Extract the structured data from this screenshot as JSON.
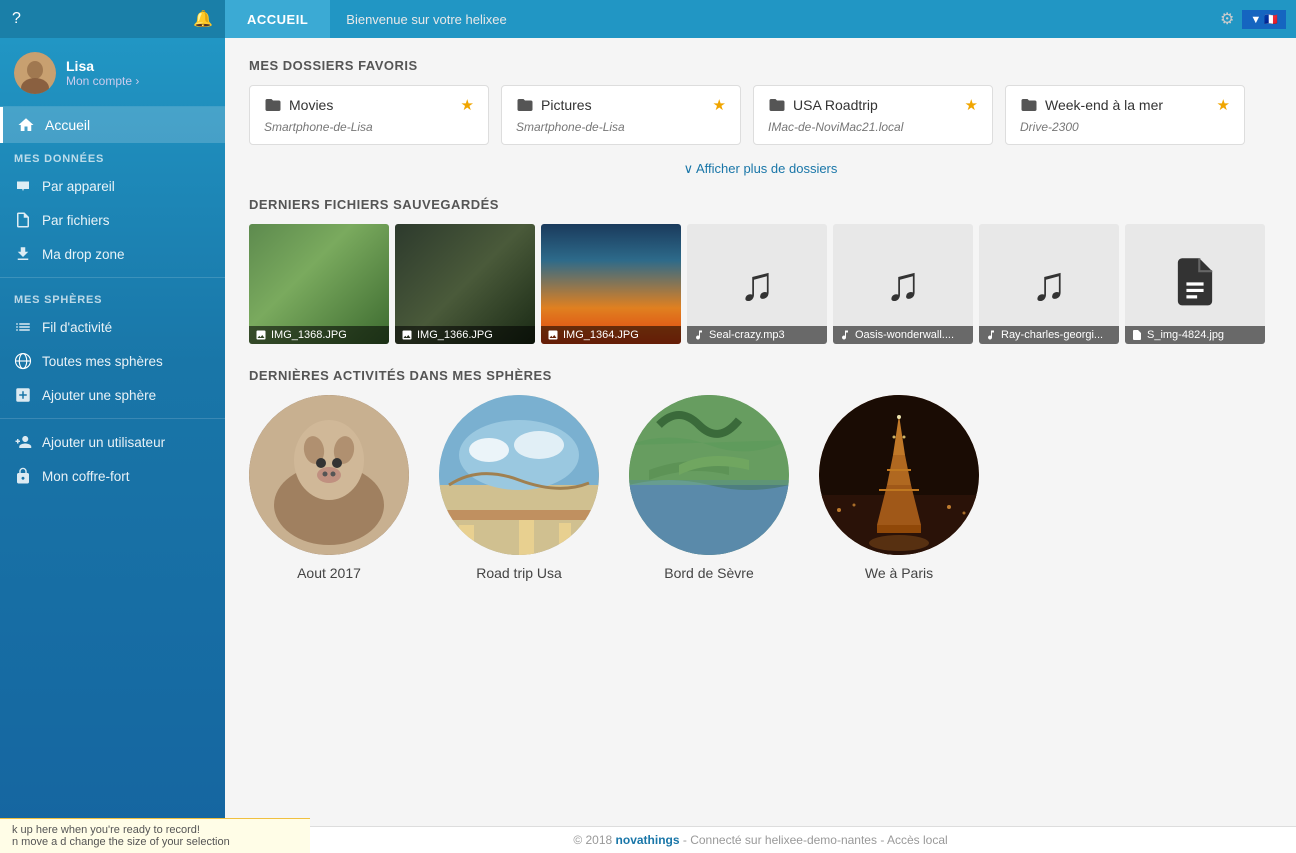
{
  "topbar": {
    "nav_label": "ACCUEIL",
    "welcome_text": "Bienvenue sur votre helixee",
    "flag_label": "▼ 🇫🇷"
  },
  "sidebar": {
    "user": {
      "name": "Lisa",
      "account_link": "Mon compte ›"
    },
    "home_label": "Accueil",
    "my_data_label": "MES DONNÉES",
    "items_data": [
      {
        "label": "Par appareil",
        "icon": "device-icon"
      },
      {
        "label": "Par fichiers",
        "icon": "files-icon"
      },
      {
        "label": "Ma drop zone",
        "icon": "dropzone-icon"
      }
    ],
    "my_spheres_label": "MES SPHÈRES",
    "items_spheres": [
      {
        "label": "Fil d'activité",
        "icon": "activity-icon"
      },
      {
        "label": "Toutes mes sphères",
        "icon": "spheres-icon"
      },
      {
        "label": "Ajouter une sphère",
        "icon": "add-sphere-icon"
      }
    ],
    "items_extra": [
      {
        "label": "Ajouter un utilisateur",
        "icon": "add-user-icon"
      },
      {
        "label": "Mon coffre-fort",
        "icon": "vault-icon"
      }
    ]
  },
  "content": {
    "section_favorites": "MES DOSSIERS FAVORIS",
    "folders": [
      {
        "name": "Movies",
        "device": "Smartphone-de-Lisa"
      },
      {
        "name": "Pictures",
        "device": "Smartphone-de-Lisa"
      },
      {
        "name": "USA Roadtrip",
        "device": "IMac-de-NoviMac21.local"
      },
      {
        "name": "Week-end à la mer",
        "device": "Drive-2300"
      }
    ],
    "show_more": "∨  Afficher plus de dossiers",
    "section_recent": "DERNIERS FICHIERS SAUVEGARDÉS",
    "recent_files": [
      {
        "name": "IMG_1368.JPG",
        "type": "photo",
        "color": "park1"
      },
      {
        "name": "IMG_1366.JPG",
        "type": "photo",
        "color": "park2"
      },
      {
        "name": "IMG_1364.JPG",
        "type": "photo",
        "color": "sunset"
      },
      {
        "name": "Seal-crazy.mp3",
        "type": "music"
      },
      {
        "name": "Oasis-wonderwall....",
        "type": "music"
      },
      {
        "name": "Ray-charles-georgi...",
        "type": "music"
      },
      {
        "name": "S_img-4824.jpg",
        "type": "doc"
      }
    ],
    "section_spheres": "DERNIÈRES ACTIVITÉS DANS MES SPHÈRES",
    "spheres": [
      {
        "label": "Aout 2017",
        "color": "cow"
      },
      {
        "label": "Road trip Usa",
        "color": "roadtrip"
      },
      {
        "label": "Bord de Sèvre",
        "color": "bord"
      },
      {
        "label": "We à Paris",
        "color": "paris"
      }
    ]
  },
  "footer": {
    "text": "© 2018 novathings - Connecté sur helixee-demo-nantes - Accès local"
  },
  "recording_bar": {
    "line1": "k up here when you're ready to record!",
    "line2": "n move a d change the size of your selection"
  }
}
